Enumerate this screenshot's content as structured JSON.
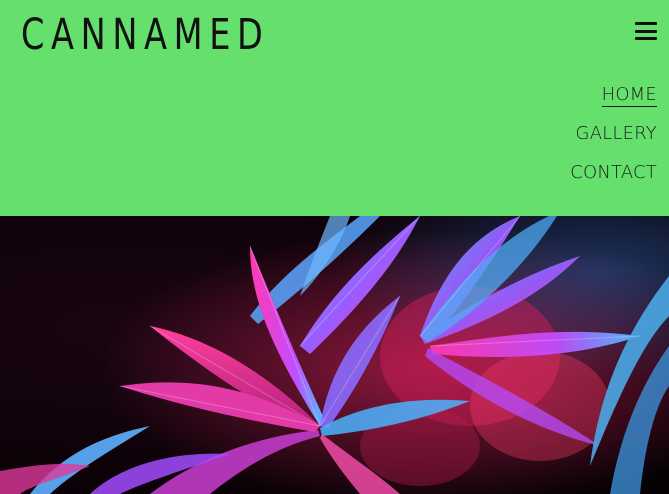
{
  "brand": {
    "logo_text": "CANNAMED"
  },
  "header": {
    "background_color": "#66e06c",
    "menu_icon": "hamburger-menu-icon"
  },
  "nav": {
    "items": [
      {
        "label": "HOME",
        "active": true
      },
      {
        "label": "GALLERY",
        "active": false
      },
      {
        "label": "CONTACT",
        "active": false
      }
    ]
  },
  "hero": {
    "image_subject": "cannabis leaves under magenta and cyan light",
    "accent_colors": [
      "#ff2fa8",
      "#3fb6ff",
      "#c43cff"
    ]
  }
}
